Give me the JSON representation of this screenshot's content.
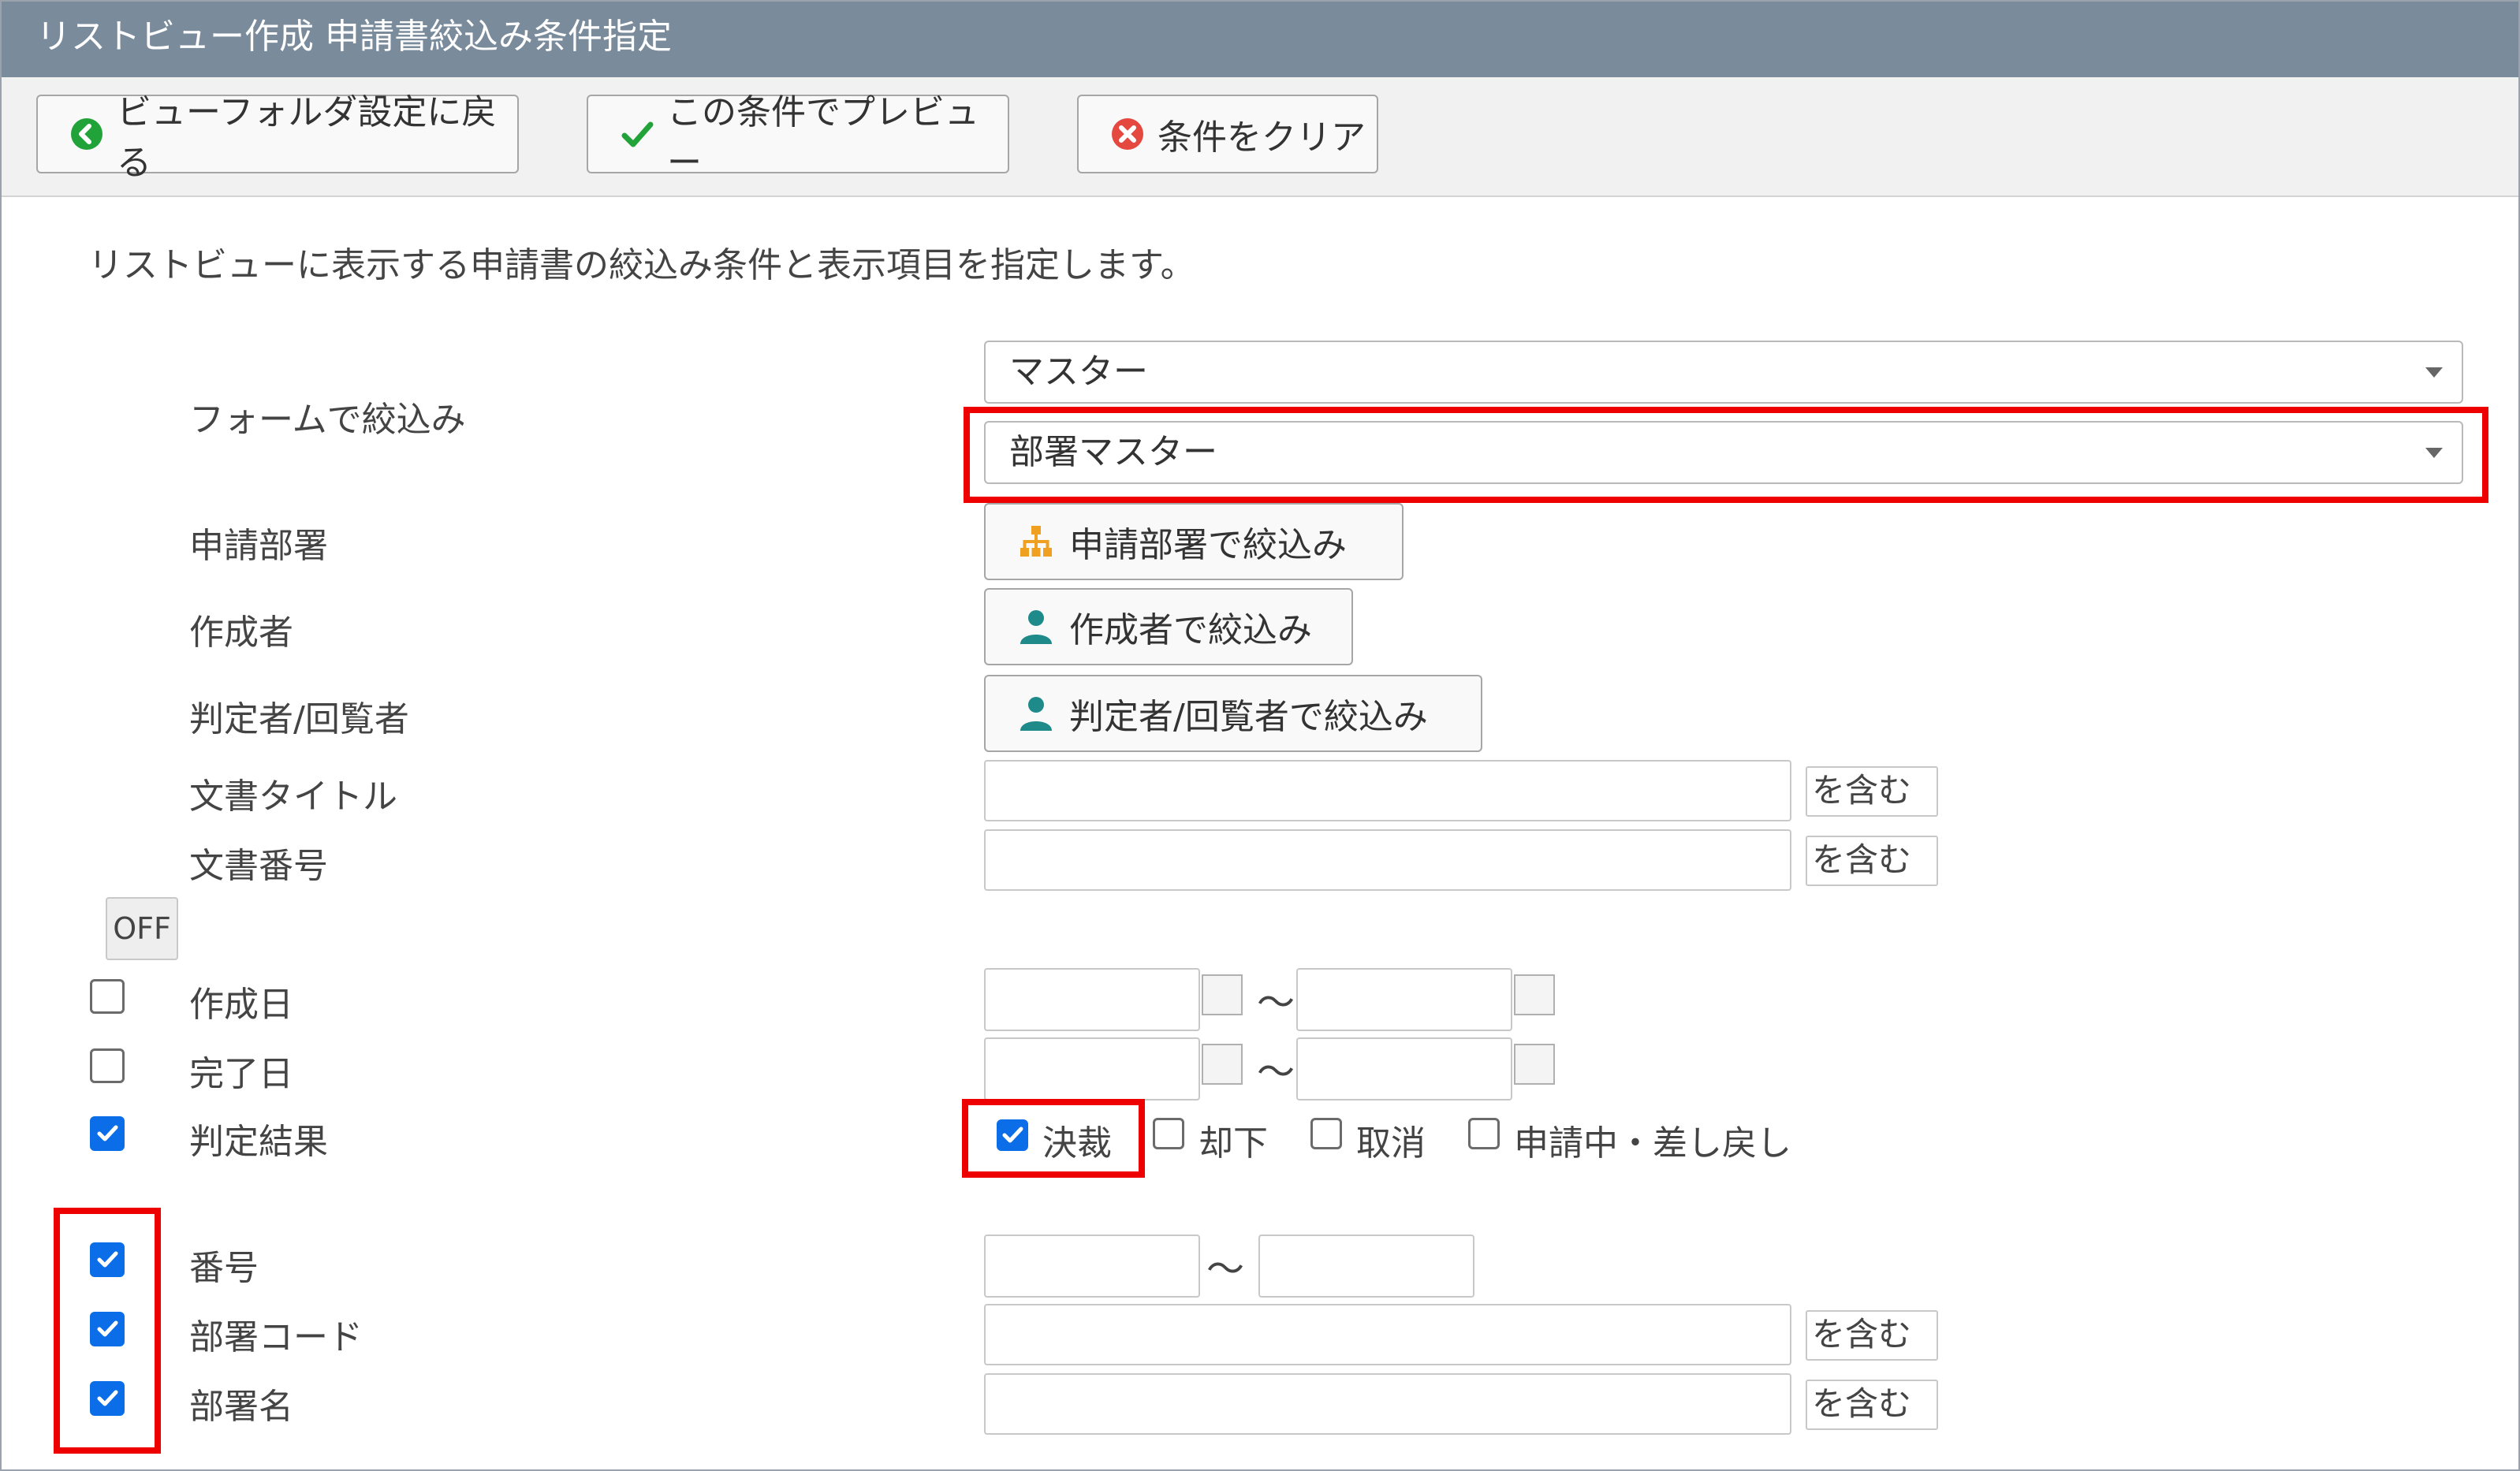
{
  "window": {
    "title": "リストビュー作成 申請書絞込み条件指定"
  },
  "toolbar": {
    "back_label": "ビューフォルダ設定に戻る",
    "preview_label": "この条件でプレビュー",
    "clear_label": "条件をクリア"
  },
  "description": "リストビューに表示する申請書の絞込み条件と表示項目を指定します。",
  "filters": {
    "form": {
      "label": "フォームで絞込み",
      "category_value": "マスター",
      "form_value": "部署マスター"
    },
    "dept": {
      "label": "申請部署",
      "button_label": "申請部署で絞込み"
    },
    "author": {
      "label": "作成者",
      "button_label": "作成者で絞込み"
    },
    "judge": {
      "label": "判定者/回覧者",
      "button_label": "判定者/回覧者で絞込み"
    },
    "doc_title": {
      "label": "文書タイトル",
      "value": "",
      "match": "を含む"
    },
    "doc_number": {
      "label": "文書番号",
      "value": "",
      "match": "を含む"
    }
  },
  "off_button": "OFF",
  "tilde": "～",
  "rows": {
    "created": {
      "label": "作成日",
      "checked": false,
      "from": "",
      "to": ""
    },
    "completed": {
      "label": "完了日",
      "checked": false,
      "from": "",
      "to": ""
    },
    "result": {
      "label": "判定結果",
      "checked": true,
      "options": [
        {
          "label": "決裁",
          "checked": true
        },
        {
          "label": "却下",
          "checked": false
        },
        {
          "label": "取消",
          "checked": false
        },
        {
          "label": "申請中・差し戻し",
          "checked": false
        }
      ]
    },
    "number": {
      "label": "番号",
      "checked": true,
      "from": "",
      "to": ""
    },
    "dept_code": {
      "label": "部署コード",
      "checked": true,
      "value": "",
      "match": "を含む"
    },
    "dept_name": {
      "label": "部署名",
      "checked": true,
      "value": "",
      "match": "を含む"
    }
  },
  "colors": {
    "titlebar": "#7a8b9c",
    "checkbox": "#0b6ee8",
    "highlight": "#ee0000",
    "check_green": "#22a33a",
    "clear_red": "#e5483f",
    "org_orange": "#f0a020",
    "person_teal": "#1f8a8a"
  }
}
